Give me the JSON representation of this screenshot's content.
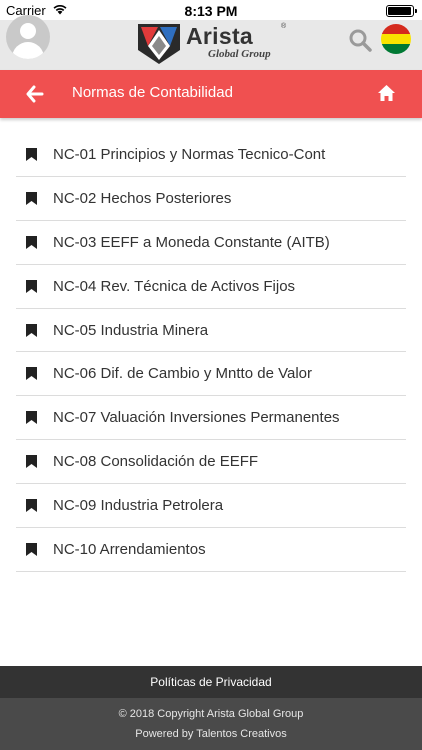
{
  "status_bar": {
    "carrier": "Carrier",
    "time": "8:13 PM",
    "battery_level": 1.0
  },
  "header": {
    "logo_title": "Arista",
    "logo_subtitle": "Global Group",
    "logo_registered": "®",
    "icons": [
      "avatar-icon",
      "search-icon",
      "bolivia-flag-icon"
    ],
    "flag_colors": [
      "#d52b1e",
      "#f9e300",
      "#007934"
    ]
  },
  "title_bar": {
    "title": "Normas de Contabilidad",
    "background": "#f05050",
    "left_icon": "back-arrow-icon",
    "right_icon": "home-icon"
  },
  "list": {
    "icon": "bookmark-icon",
    "items": [
      {
        "label": "NC-01 Principios y Normas Tecnico-Cont"
      },
      {
        "label": "NC-02 Hechos Posteriores"
      },
      {
        "label": "NC-03 EEFF a Moneda Constante (AITB)"
      },
      {
        "label": "NC-04 Rev. Técnica de Activos Fijos"
      },
      {
        "label": "NC-05 Industria Minera"
      },
      {
        "label": "NC-06 Dif. de Cambio y Mntto de Valor"
      },
      {
        "label": "NC-07 Valuación Inversiones Permanentes"
      },
      {
        "label": "NC-08 Consolidación de EEFF"
      },
      {
        "label": "NC-09 Industria Petrolera"
      },
      {
        "label": "NC-10 Arrendamientos"
      }
    ]
  },
  "footer": {
    "privacy_link": "Políticas de Privacidad",
    "copyright": "© 2018 Copyright Arista Global Group",
    "powered_by": "Powered by Talentos Creativos"
  }
}
